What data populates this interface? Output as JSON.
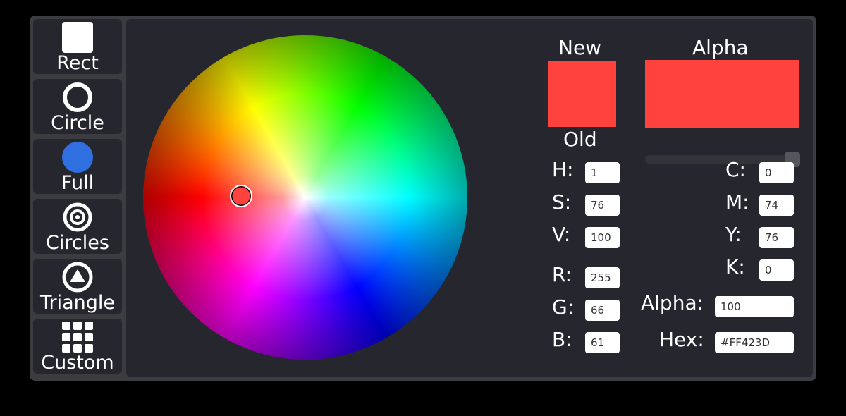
{
  "sidebar": {
    "items": [
      {
        "label": "Rect",
        "icon": "square-icon"
      },
      {
        "label": "Circle",
        "icon": "ring-icon"
      },
      {
        "label": "Full",
        "icon": "filled-circle-icon"
      },
      {
        "label": "Circles",
        "icon": "concentric-circles-icon"
      },
      {
        "label": "Triangle",
        "icon": "triangle-in-circle-icon"
      },
      {
        "label": "Custom",
        "icon": "grid-icon"
      }
    ]
  },
  "picker": {
    "new_label": "New",
    "old_label": "Old",
    "alpha_label": "Alpha",
    "new_color": "#FF423D",
    "alpha_color": "#FF423D",
    "alpha_slider_value": 1.0,
    "cursor_hue_deg": 1,
    "cursor_saturation": 0.76
  },
  "hsv": {
    "h_label": "H:",
    "h_value": "1",
    "s_label": "S:",
    "s_value": "76",
    "v_label": "V:",
    "v_value": "100"
  },
  "rgb": {
    "r_label": "R:",
    "r_value": "255",
    "g_label": "G:",
    "g_value": "66",
    "b_label": "B:",
    "b_value": "61"
  },
  "cmyk": {
    "c_label": "C:",
    "c_value": "0",
    "m_label": "M:",
    "m_value": "74",
    "y_label": "Y:",
    "y_value": "76",
    "k_label": "K:",
    "k_value": "0"
  },
  "extra": {
    "alpha_label": "Alpha:",
    "alpha_value": "100",
    "hex_label": "Hex:",
    "hex_value": "#FF423D"
  },
  "colors": {
    "window_bg": "#3b3b40",
    "panel_bg": "#26262e",
    "full_icon": "#2f6fe0"
  }
}
